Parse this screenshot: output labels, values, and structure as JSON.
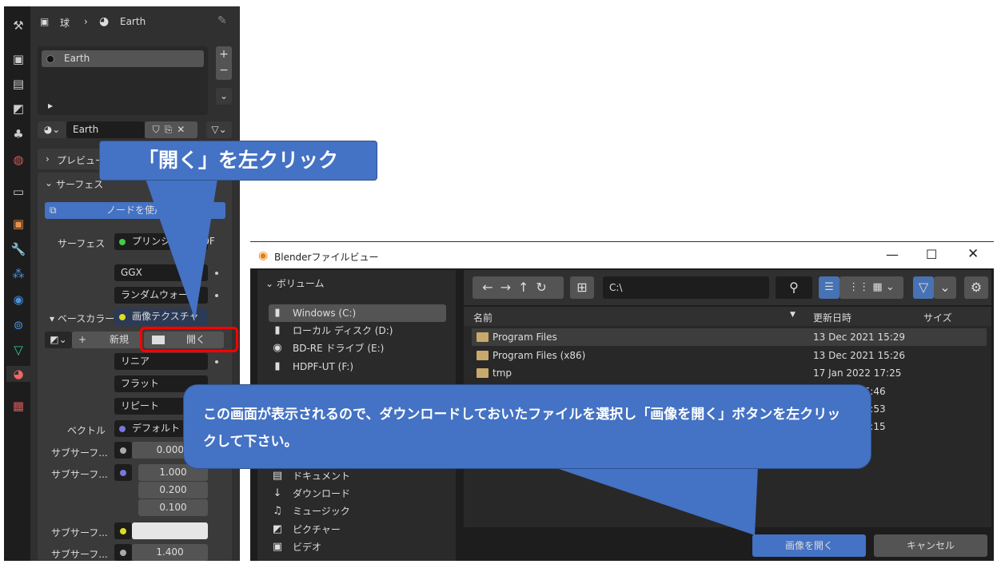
{
  "properties": {
    "breadcrumb": {
      "object": "球",
      "material": "Earth"
    },
    "slot_list": [
      "Earth"
    ],
    "material_name": "Earth",
    "preview_label": "プレビュー",
    "surface_label": "サーフェス",
    "use_nodes": "ノードを使用",
    "surface_field_label": "サーフェス",
    "surface_value": "プリンシプルBSDF",
    "distribution": "GGX",
    "subsurface_method": "ランダムウォーク",
    "base_color_label": "ベースカラー",
    "base_color_value": "画像テクスチャ",
    "new_button": "新規",
    "open_button": "開く",
    "interpolation": "リニア",
    "projection": "フラット",
    "extension": "リピート",
    "vector_label": "ベクトル",
    "vector_value": "デフォルト",
    "rows": [
      {
        "label": "サブサーフ...",
        "value": "0.000"
      },
      {
        "label": "サブサーフ...",
        "values": [
          "1.000",
          "0.200",
          "0.100"
        ]
      },
      {
        "label": "サブサーフ...",
        "value": ""
      },
      {
        "label": "サブサーフ...",
        "value": "1.400"
      }
    ]
  },
  "dialog": {
    "title": "Blenderファイルビュー",
    "volumes_header": "ボリューム",
    "volumes": [
      "Windows (C:)",
      "ローカル ディスク (D:)",
      "BD-RE ドライブ (E:)",
      "HDPF-UT (F:)"
    ],
    "places": [
      "ドキュメント",
      "ダウンロード",
      "ミュージック",
      "ピクチャー",
      "ビデオ"
    ],
    "path": "C:\\",
    "columns": [
      "名前",
      "更新日時",
      "サイズ"
    ],
    "files": [
      {
        "name": "Program Files",
        "date": "13 Dec 2021 15:29"
      },
      {
        "name": "Program Files (x86)",
        "date": "13 Dec 2021 15:26"
      },
      {
        "name": "tmp",
        "date": "17 Jan 2022 17:25"
      },
      {
        "name": "",
        "date": "16:46"
      },
      {
        "name": "",
        "date": "07:53"
      },
      {
        "name": "",
        "date": "14:15"
      }
    ],
    "filename": "",
    "open_image_button": "画像を開く",
    "cancel_button": "キャンセル"
  },
  "callouts": {
    "top": "「開く」を左クリック",
    "bottom": "この画面が表示されるので、ダウンロードしておいたファイルを選択し「画像を開く」ボタンを左クリックして下さい。"
  },
  "colors": {
    "accent": "#4472c4",
    "highlight": "#ff0000",
    "panel": "#303030"
  }
}
